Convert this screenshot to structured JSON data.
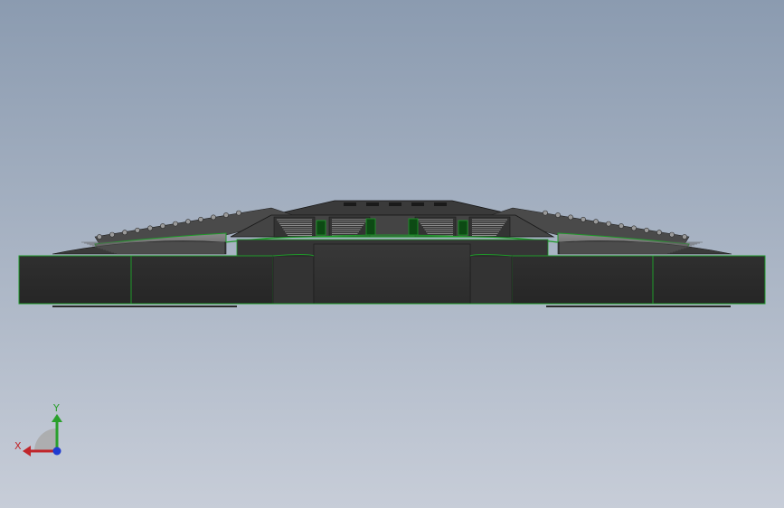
{
  "viewport": {
    "background_top": "#8c9cb1",
    "background_bottom": "#c6ccd7",
    "edge_color": "#1f9a2a",
    "body_color": "#2b2b2b"
  },
  "triad": {
    "x_label": "X",
    "y_label": "Y",
    "x_color": "#c0262b",
    "y_color": "#2aa02c",
    "z_color": "#1f3cd1"
  }
}
